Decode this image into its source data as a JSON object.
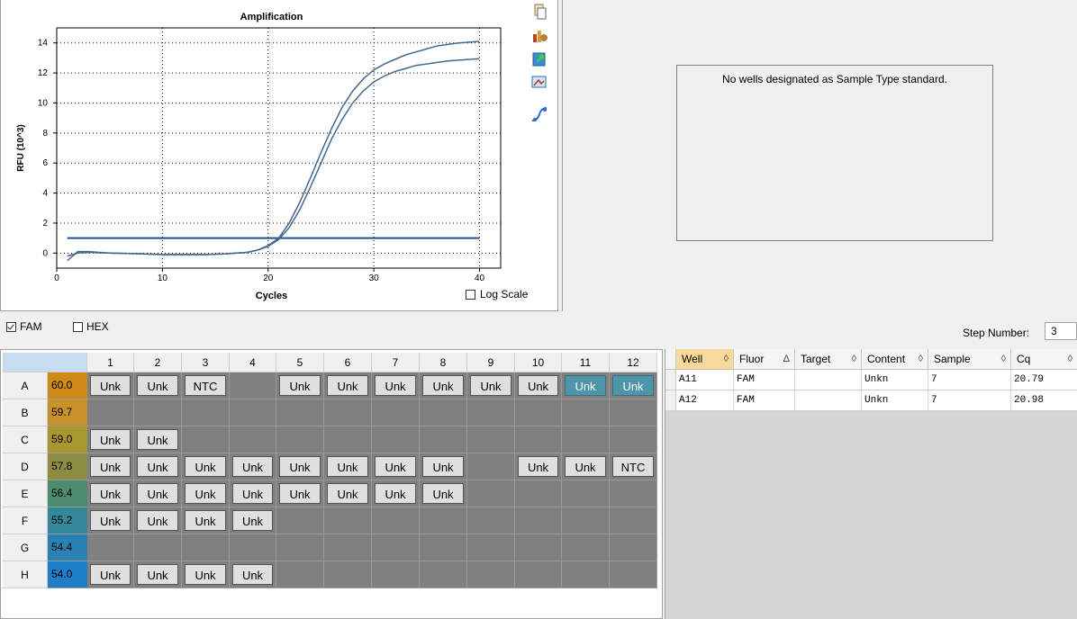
{
  "chart": {
    "title": "Amplification",
    "xlabel": "Cycles",
    "ylabel": "RFU (10^3)",
    "log_scale_label": "Log Scale",
    "log_scale_checked": false
  },
  "chart_data": {
    "type": "line",
    "title": "Amplification",
    "xlabel": "Cycles",
    "ylabel": "RFU (10^3)",
    "xlim": [
      0,
      42
    ],
    "ylim": [
      -1,
      15
    ],
    "xticks": [
      0,
      10,
      20,
      30,
      40
    ],
    "yticks": [
      0,
      2,
      4,
      6,
      8,
      10,
      12,
      14
    ],
    "grid": true,
    "threshold": 1.0,
    "series": [
      {
        "x": [
          1,
          2,
          3,
          5,
          8,
          10,
          12,
          14,
          16,
          18,
          19,
          20,
          21,
          22,
          23,
          24,
          25,
          26,
          27,
          28,
          29,
          30,
          31,
          32,
          33,
          34,
          35,
          36,
          37,
          38,
          39,
          40
        ],
        "values": [
          -0.5,
          0.1,
          0.1,
          0,
          -0.05,
          -0.1,
          -0.1,
          -0.1,
          -0.05,
          0.05,
          0.2,
          0.5,
          1.0,
          2.0,
          3.4,
          5.0,
          6.7,
          8.3,
          9.7,
          10.8,
          11.6,
          12.2,
          12.6,
          12.9,
          13.2,
          13.4,
          13.6,
          13.8,
          13.9,
          14.0,
          14.05,
          14.1
        ],
        "color": "#44698e"
      },
      {
        "x": [
          1,
          2,
          3,
          5,
          8,
          10,
          12,
          14,
          16,
          18,
          19,
          20,
          21,
          22,
          23,
          24,
          25,
          26,
          27,
          28,
          29,
          30,
          31,
          32,
          33,
          34,
          35,
          36,
          37,
          38,
          39,
          40
        ],
        "values": [
          -0.2,
          0.0,
          0.05,
          0,
          -0.05,
          -0.1,
          -0.1,
          -0.1,
          -0.05,
          0.05,
          0.2,
          0.45,
          0.9,
          1.7,
          2.9,
          4.4,
          6.0,
          7.6,
          8.9,
          10.0,
          10.8,
          11.4,
          11.8,
          12.1,
          12.3,
          12.5,
          12.6,
          12.7,
          12.8,
          12.85,
          12.9,
          12.95
        ],
        "color": "#44698e"
      }
    ]
  },
  "toolbar_icons": [
    "copy-icon",
    "chart-settings-icon",
    "export-icon",
    "image-export-icon",
    "curve-icon"
  ],
  "standard": {
    "message": "No wells designated as Sample Type standard."
  },
  "fluor": {
    "fam_label": "FAM",
    "fam_checked": true,
    "hex_label": "HEX",
    "hex_checked": false,
    "step_label": "Step Number:",
    "step_value": "3"
  },
  "plate": {
    "columns": [
      "1",
      "2",
      "3",
      "4",
      "5",
      "6",
      "7",
      "8",
      "9",
      "10",
      "11",
      "12"
    ],
    "rows": [
      {
        "label": "A",
        "temp": "60.0",
        "temp_color": "#d08a18",
        "wells": [
          "Unk",
          "Unk",
          "NTC",
          "",
          "Unk",
          "Unk",
          "Unk",
          "Unk",
          "Unk",
          "Unk",
          "Unk",
          "Unk"
        ],
        "selected": [
          10,
          11
        ]
      },
      {
        "label": "B",
        "temp": "59.7",
        "temp_color": "#c9912a",
        "wells": [
          "",
          "",
          "",
          "",
          "",
          "",
          "",
          "",
          "",
          "",
          "",
          ""
        ],
        "selected": []
      },
      {
        "label": "C",
        "temp": "59.0",
        "temp_color": "#a8962e",
        "wells": [
          "Unk",
          "Unk",
          "",
          "",
          "",
          "",
          "",
          "",
          "",
          "",
          "",
          ""
        ],
        "selected": []
      },
      {
        "label": "D",
        "temp": "57.8",
        "temp_color": "#8c8d40",
        "wells": [
          "Unk",
          "Unk",
          "Unk",
          "Unk",
          "Unk",
          "Unk",
          "Unk",
          "Unk",
          "",
          "Unk",
          "Unk",
          "NTC"
        ],
        "selected": []
      },
      {
        "label": "E",
        "temp": "56.4",
        "temp_color": "#4d8a70",
        "wells": [
          "Unk",
          "Unk",
          "Unk",
          "Unk",
          "Unk",
          "Unk",
          "Unk",
          "Unk",
          "",
          "",
          "",
          ""
        ],
        "selected": []
      },
      {
        "label": "F",
        "temp": "55.2",
        "temp_color": "#33889a",
        "wells": [
          "Unk",
          "Unk",
          "Unk",
          "Unk",
          "",
          "",
          "",
          "",
          "",
          "",
          "",
          ""
        ],
        "selected": []
      },
      {
        "label": "G",
        "temp": "54.4",
        "temp_color": "#2a82b4",
        "wells": [
          "",
          "",
          "",
          "",
          "",
          "",
          "",
          "",
          "",
          "",
          "",
          ""
        ],
        "selected": []
      },
      {
        "label": "H",
        "temp": "54.0",
        "temp_color": "#1f7ec8",
        "wells": [
          "Unk",
          "Unk",
          "Unk",
          "Unk",
          "",
          "",
          "",
          "",
          "",
          "",
          "",
          ""
        ],
        "selected": []
      }
    ]
  },
  "results": {
    "headers": [
      "Well",
      "Fluor",
      "Target",
      "Content",
      "Sample",
      "Cq"
    ],
    "rows": [
      [
        "A11",
        "FAM",
        "",
        "Unkn",
        "7",
        "20.79"
      ],
      [
        "A12",
        "FAM",
        "",
        "Unkn",
        "7",
        "20.98"
      ]
    ]
  }
}
